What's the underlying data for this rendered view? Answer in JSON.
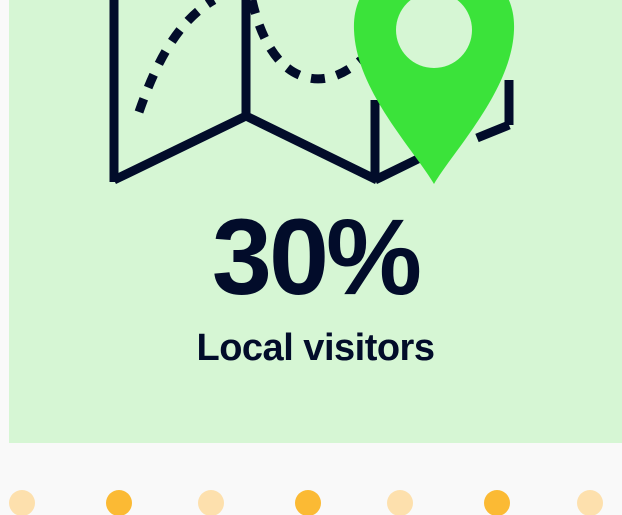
{
  "stat": {
    "value": "30%",
    "label": "Local visitors"
  },
  "icons": {
    "map": "folded-map-icon",
    "pin": "location-pin-icon"
  },
  "colors": {
    "card_background": "#d6f6d4",
    "page_background": "#f9f9f9",
    "text": "#020c2a",
    "pin": "#3be33a",
    "dot_light": "#fde0ad",
    "dot_dark": "#fbba34"
  },
  "decorations": {
    "dots": [
      "light",
      "dark",
      "light",
      "dark",
      "light",
      "dark",
      "light"
    ]
  }
}
